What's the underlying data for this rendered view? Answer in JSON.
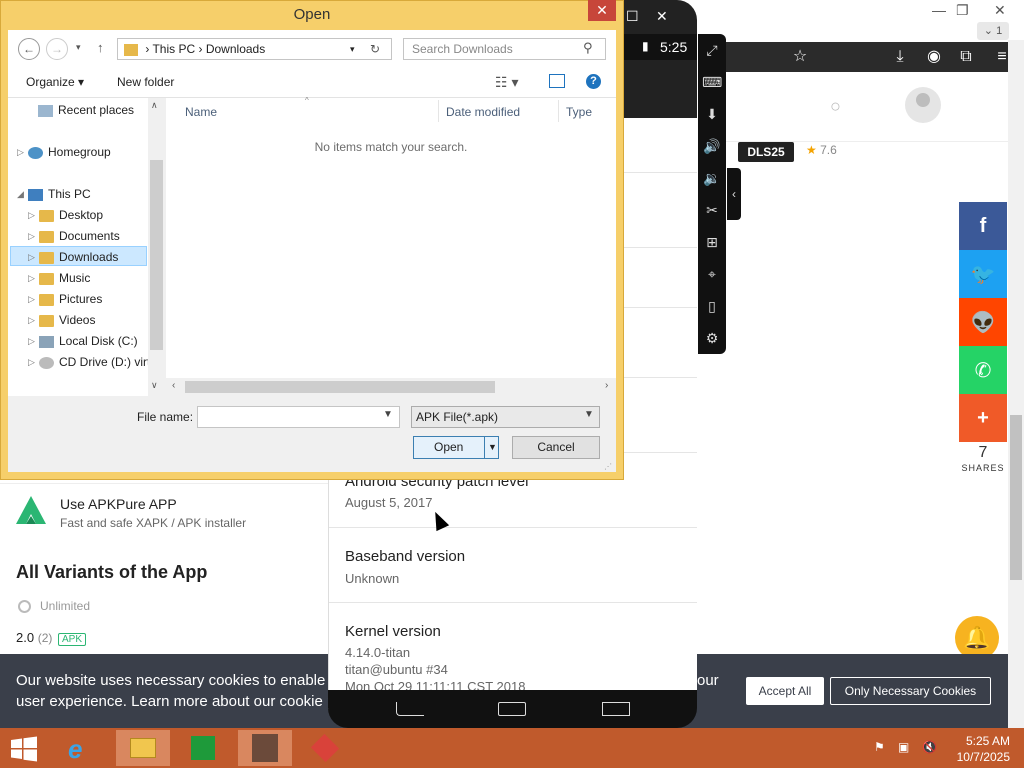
{
  "dialog": {
    "title": "Open",
    "close": "✕",
    "address": {
      "root": "This PC",
      "sep": "›",
      "current": "Downloads"
    },
    "search_placeholder": "Search Downloads",
    "organize": "Organize ▾",
    "new_folder": "New folder",
    "tree": {
      "recent": "Recent places",
      "homegroup": "Homegroup",
      "this_pc": "This PC",
      "desktop": "Desktop",
      "documents": "Documents",
      "downloads": "Downloads",
      "music": "Music",
      "pictures": "Pictures",
      "videos": "Videos",
      "local_disk": "Local Disk (C:)",
      "cd_drive": "CD Drive (D:) virt"
    },
    "columns": {
      "name": "Name",
      "date": "Date modified",
      "type": "Type"
    },
    "empty_message": "No items match your search.",
    "file_name_label": "File name:",
    "file_name_value": "",
    "file_type": "APK File(*.apk)",
    "open_label": "Open",
    "cancel_label": "Cancel"
  },
  "emulator": {
    "time": "5:25",
    "settings": [
      {
        "title": "Android security patch level",
        "value": "August 5, 2017"
      },
      {
        "title": "Baseband version",
        "value": "Unknown"
      },
      {
        "title": "Kernel version",
        "lines": [
          "4.14.0-titan",
          "titan@ubuntu #34",
          "Mon Oct 29 11:11:11 CST 2018"
        ]
      }
    ]
  },
  "webpage": {
    "tab_count": "1",
    "badge": "DLS25",
    "rating": "7.6",
    "apkpure": {
      "title": "Use APKPure APP",
      "subtitle": "Fast and safe XAPK / APK installer"
    },
    "variants_heading": "All Variants of the App",
    "unlimited": "Unlimited",
    "version": "2.0",
    "version_count": "(2)",
    "version_tag": "APK",
    "share_count": "7",
    "share_label": "SHARES",
    "share_buttons": [
      {
        "name": "facebook",
        "glyph": "f",
        "color": "#3b5998"
      },
      {
        "name": "twitter",
        "glyph": "🐦",
        "color": "#1da1f2"
      },
      {
        "name": "reddit",
        "glyph": "👽",
        "color": "#ff4500"
      },
      {
        "name": "whatsapp",
        "glyph": "✆",
        "color": "#25d366"
      },
      {
        "name": "more",
        "glyph": "+",
        "color": "#f05a28"
      }
    ],
    "cookie": {
      "text_line1": "Our website uses necessary cookies to enable ba",
      "text_line2": "user experience. Learn more about our cookie po",
      "text_tail": "our",
      "accept_all": "Accept All",
      "only_necessary": "Only Necessary Cookies"
    }
  },
  "taskbar": {
    "time": "5:25 AM",
    "date": "10/7/2025"
  },
  "colors": {
    "dialog_frame": "#f6cf6a",
    "taskbar": "#c05a2c",
    "cookie_bar": "#3a3f4a"
  }
}
